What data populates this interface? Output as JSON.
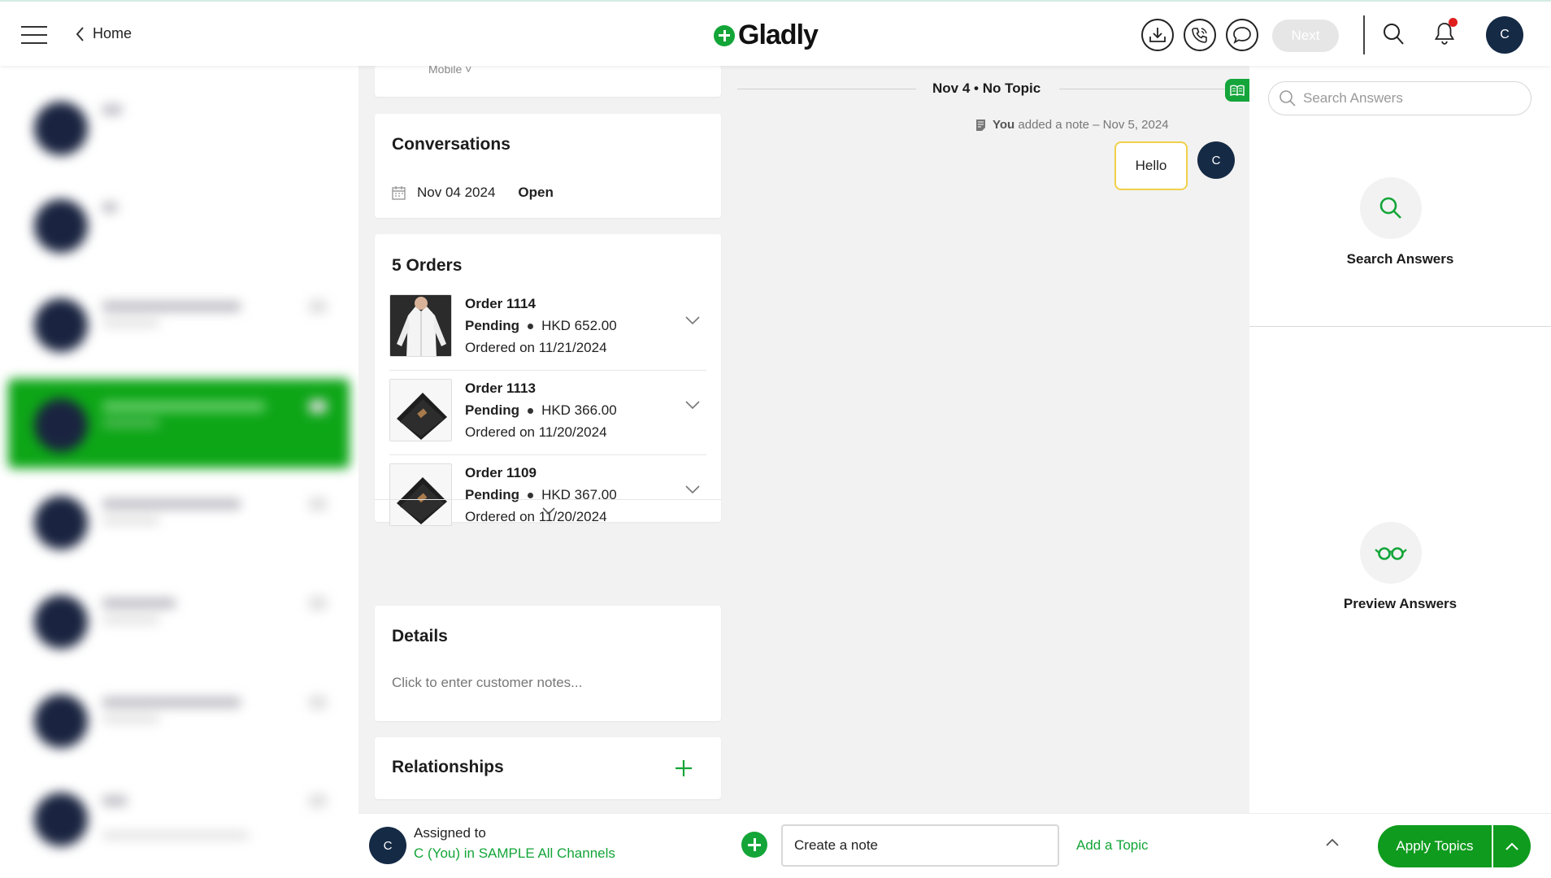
{
  "header": {
    "home_label": "Home",
    "logo_text": "Gladly",
    "next_label": "Next",
    "avatar_initial": "C",
    "brand_color": "#13a538"
  },
  "left_list": {
    "note": "",
    "items_count_visible": 8
  },
  "customer": {
    "top_card_label": "Mobile ˅",
    "conversations": {
      "title": "Conversations",
      "date": "Nov 04 2024",
      "status": "Open"
    },
    "orders": {
      "title": "5 Orders",
      "items": [
        {
          "title": "Order 1114",
          "status": "Pending",
          "amount": "HKD 652.00",
          "date": "Ordered on 11/21/2024",
          "thumb": "white-shirt"
        },
        {
          "title": "Order 1113",
          "status": "Pending",
          "amount": "HKD 366.00",
          "date": "Ordered on 11/20/2024",
          "thumb": "black-jeans"
        },
        {
          "title": "Order 1109",
          "status": "Pending",
          "amount": "HKD 367.00",
          "date": "Ordered on 11/20/2024",
          "thumb": "black-jeans"
        }
      ]
    },
    "details": {
      "title": "Details",
      "placeholder": "Click to enter customer notes..."
    },
    "relationships": {
      "title": "Relationships"
    }
  },
  "conversation": {
    "timeline_label": "Nov 4 • No Topic",
    "note_meta_you": "You",
    "note_meta_rest": "added a note – Nov 5, 2024",
    "message": "Hello",
    "author_initial": "C",
    "note_accent": "#f1d04a"
  },
  "answers": {
    "search_placeholder": "Search Answers",
    "search_label": "Search Answers",
    "preview_label": "Preview Answers"
  },
  "bottom": {
    "assigned_label": "Assigned to",
    "assigned_value": "C (You) in SAMPLE All Channels",
    "assignee_initial": "C",
    "note_placeholder": "Create a note",
    "add_topic_label": "Add a Topic",
    "apply_label": "Apply Topics"
  }
}
